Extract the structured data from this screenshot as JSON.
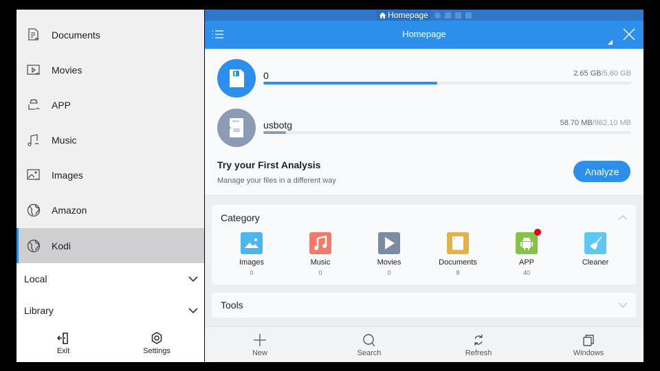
{
  "drawer": {
    "items": [
      {
        "label": "Documents",
        "icon": "document-remote-icon"
      },
      {
        "label": "Movies",
        "icon": "movie-remote-icon"
      },
      {
        "label": "APP",
        "icon": "app-remote-icon"
      },
      {
        "label": "Music",
        "icon": "music-remote-icon"
      },
      {
        "label": "Images",
        "icon": "image-remote-icon"
      },
      {
        "label": "Amazon",
        "icon": "globe-icon"
      },
      {
        "label": "Kodi",
        "icon": "globe-icon",
        "active": true
      }
    ],
    "sections": [
      {
        "label": "Local"
      },
      {
        "label": "Library"
      }
    ],
    "bottom": {
      "exit_label": "Exit",
      "settings_label": "Settings"
    }
  },
  "statusbar": {
    "title": "Homepage"
  },
  "appbar": {
    "title": "Homepage"
  },
  "storage": [
    {
      "name": "0",
      "used": "2.65 GB",
      "total": "/5.60 GB",
      "fraction": 0.473,
      "color": "#2d8fec"
    },
    {
      "name": "usbotg",
      "used": "58.70 MB",
      "total": "/962.10 MB",
      "fraction": 0.061,
      "color": "#8a9bb3"
    }
  ],
  "analysis": {
    "title": "Try your First Analysis",
    "subtitle": "Manage your files in a different way",
    "button_label": "Analyze"
  },
  "category": {
    "title": "Category",
    "items": [
      {
        "label": "Images",
        "count": "0",
        "color": "#4db6ec"
      },
      {
        "label": "Music",
        "count": "0",
        "color": "#f47b6b"
      },
      {
        "label": "Movies",
        "count": "0",
        "color": "#7b8ba3"
      },
      {
        "label": "Documents",
        "count": "8",
        "color": "#e2b24a"
      },
      {
        "label": "APP",
        "count": "40",
        "color": "#86c148",
        "badge": true
      },
      {
        "label": "Cleaner",
        "count": "",
        "color": "#5ec7f5"
      }
    ]
  },
  "tools": {
    "title": "Tools"
  },
  "bottombar": {
    "new_label": "New",
    "search_label": "Search",
    "refresh_label": "Refresh",
    "windows_label": "Windows"
  },
  "colors": {
    "accent": "#2d8fec",
    "status_bar": "#3077c9",
    "drawer_bg": "#f0f0f0",
    "active_item_bg": "#cfcfd1"
  }
}
